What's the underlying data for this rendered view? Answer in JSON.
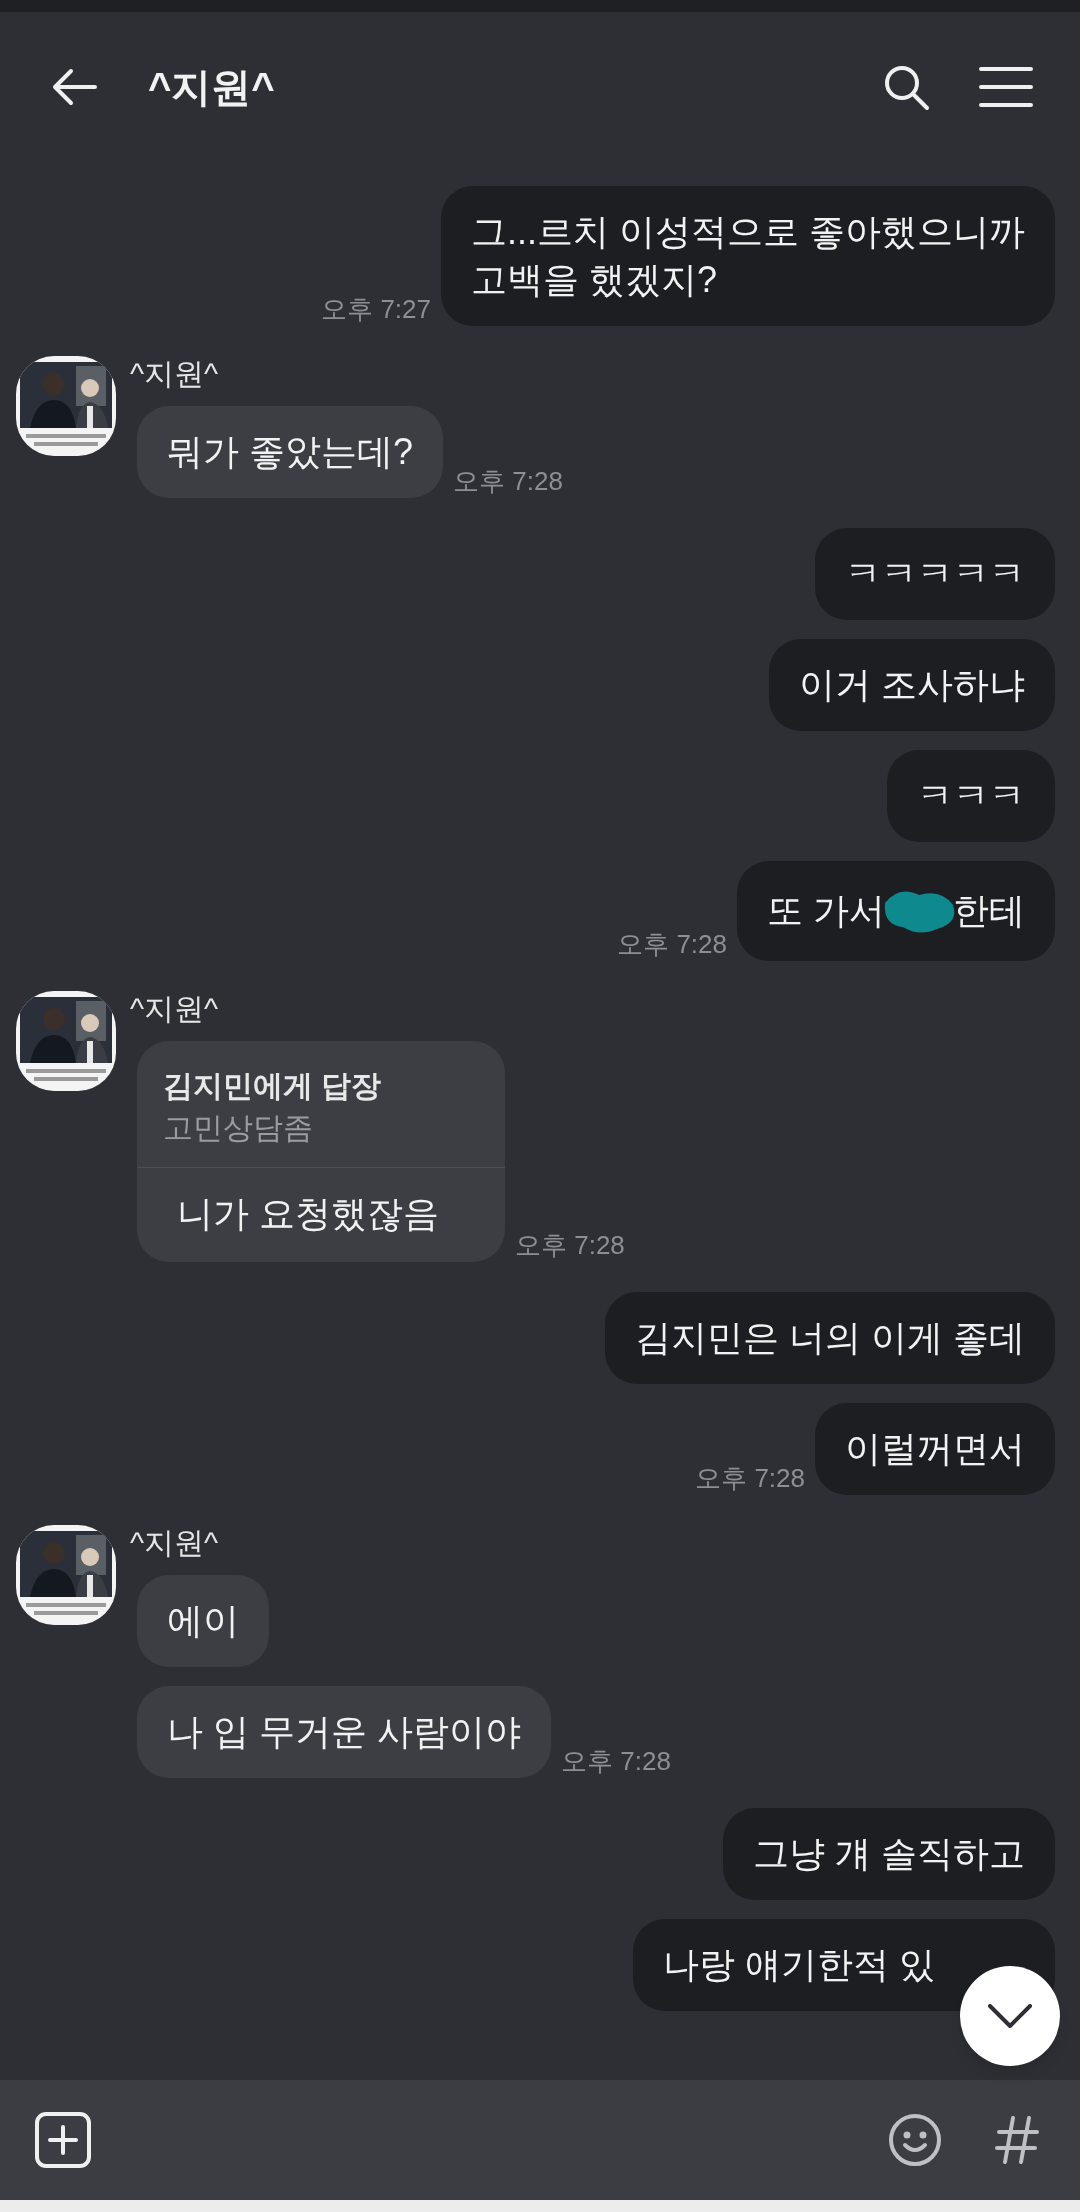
{
  "header": {
    "title": "^지원^"
  },
  "groups": [
    {
      "kind": "outgoing",
      "messages": [
        {
          "kind": "text",
          "text": "그...르치 이성적으로 좋아했으니까\n고백을 했겠지?",
          "time": "오후 7:27"
        }
      ]
    },
    {
      "kind": "incoming",
      "sender": "^지원^",
      "messages": [
        {
          "kind": "text",
          "text": "뭐가 좋았는데?",
          "time": "오후 7:28"
        }
      ]
    },
    {
      "kind": "outgoing",
      "messages": [
        {
          "kind": "text",
          "text": "ㅋㅋㅋㅋㅋ"
        },
        {
          "kind": "text",
          "text": "이거 조사하냐"
        },
        {
          "kind": "text",
          "text": "ㅋㅋㅋ"
        },
        {
          "kind": "redacted",
          "parts": [
            "또 가서",
            "한테"
          ],
          "time": "오후 7:28"
        }
      ]
    },
    {
      "kind": "incoming",
      "sender": "^지원^",
      "messages": [
        {
          "kind": "reply",
          "reply_to": "김지민에게 답장",
          "quote": "고민상담좀",
          "text": "니가 요청했잖음",
          "time": "오후 7:28"
        }
      ]
    },
    {
      "kind": "outgoing",
      "messages": [
        {
          "kind": "text",
          "text": "김지민은 너의 이게 좋데"
        },
        {
          "kind": "text",
          "text": "이럴꺼면서",
          "time": "오후 7:28"
        }
      ]
    },
    {
      "kind": "incoming",
      "sender": "^지원^",
      "messages": [
        {
          "kind": "text",
          "text": "에이"
        },
        {
          "kind": "text",
          "text": "나 입 무거운 사람이야",
          "time": "오후 7:28"
        }
      ]
    },
    {
      "kind": "outgoing",
      "messages": [
        {
          "kind": "text",
          "text": "그냥 걔 솔직하고"
        },
        {
          "kind": "covered",
          "text": "나랑 얘기한적 있"
        }
      ]
    }
  ]
}
